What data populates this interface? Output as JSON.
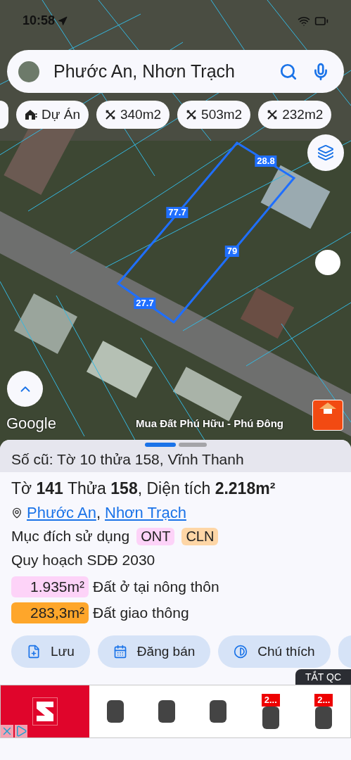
{
  "status_bar": {
    "time": "10:58"
  },
  "search": {
    "value": "Phước An, Nhơn Trạch"
  },
  "chips": [
    {
      "kind": "project",
      "label": "Dự Án"
    },
    {
      "kind": "area",
      "label": "340m2"
    },
    {
      "kind": "area",
      "label": "503m2"
    },
    {
      "kind": "area",
      "label": "232m2"
    }
  ],
  "map": {
    "edges": [
      {
        "label": "28.8"
      },
      {
        "label": "77.7"
      },
      {
        "label": "79"
      },
      {
        "label": "27.7"
      }
    ],
    "attribution": "Google",
    "overlay_label": "Mua Đất Phú Hữu - Phú Đông"
  },
  "sheet": {
    "pager": [
      {
        "selected": true
      },
      {
        "selected": false
      }
    ],
    "old_number": "Số cũ: Tờ 10 thửa 158, Vĩnh Thanh",
    "title": "Tờ **141** Thửa **158**, Diện tích **2.218m²**",
    "location": [
      {
        "label": "Phước An"
      },
      {
        "label": "Nhơn Trạch"
      }
    ],
    "location_separator": ",",
    "purpose_label": "Mục đích sử dụng",
    "purpose_tags": [
      {
        "label": "ONT",
        "color": "#fdd3f8"
      },
      {
        "label": "CLN",
        "color": "#fed6a6"
      }
    ],
    "plan_title": "Quy hoạch SDĐ 2030",
    "plan_rows": [
      {
        "area": "1.935m²",
        "label": "Đất ở tại nông thôn",
        "color": "#fdd3f8"
      },
      {
        "area": "283,3m²",
        "label": "Đất giao thông",
        "color": "#fea62a"
      }
    ],
    "actions": [
      {
        "kind": "save",
        "label": "Lưu"
      },
      {
        "kind": "post",
        "label": "Đăng bán"
      },
      {
        "kind": "legend",
        "label": "Chú thích"
      }
    ]
  },
  "ad": {
    "close_label": "TẮT QC",
    "products": [
      {
        "kind": "plain"
      },
      {
        "kind": "plain"
      },
      {
        "kind": "plain"
      },
      {
        "kind": "badged",
        "badge": "2..."
      },
      {
        "kind": "badged",
        "badge": "2..."
      }
    ]
  }
}
